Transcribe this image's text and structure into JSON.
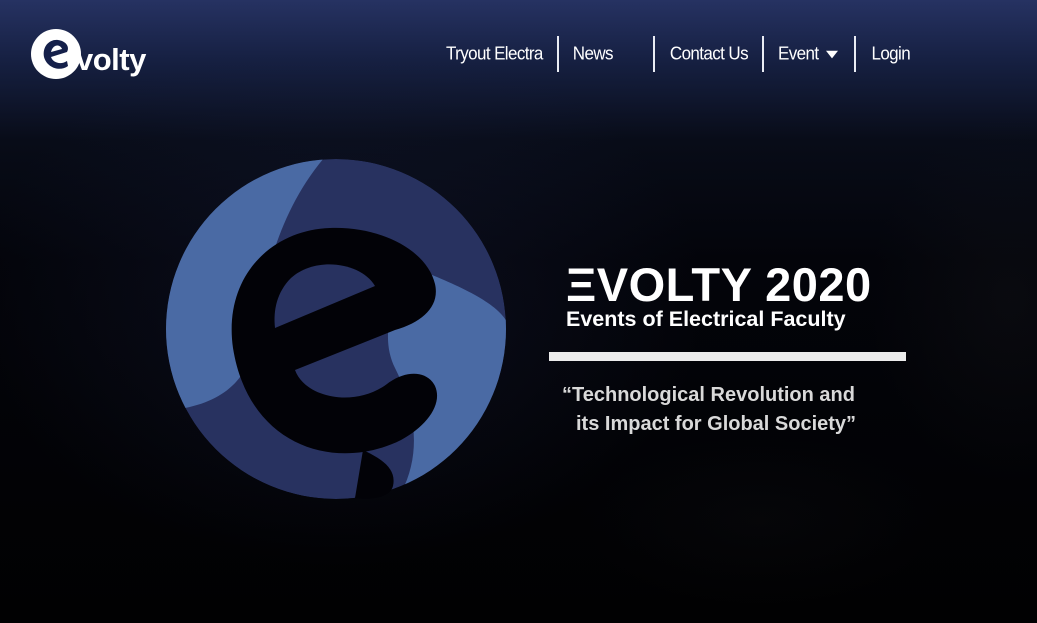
{
  "brand": {
    "name": "evolty",
    "icon": "evolty-e-logo",
    "color": "#ffffff"
  },
  "nav": {
    "items": [
      {
        "label": "Tryout Electra"
      },
      {
        "label": "News"
      },
      {
        "label": "Contact Us"
      },
      {
        "label": "Event",
        "icon": "caret-down-icon"
      },
      {
        "label": "Login"
      }
    ]
  },
  "hero": {
    "emblem_icon": "evolty-e-emblem",
    "title": "ΞVOLTY 2020",
    "subtitle": "Events of Electrical Faculty",
    "tagline_line1": "“Technological Revolution and",
    "tagline_line2": "its Impact for Global Society”"
  },
  "colors": {
    "header_top": "#263262",
    "background": "#010102",
    "emblem_light": "#4a6aa4",
    "emblem_dark": "#283260",
    "text": "#ffffff",
    "tagline": "#d9d9d9",
    "rule": "#ececec"
  }
}
